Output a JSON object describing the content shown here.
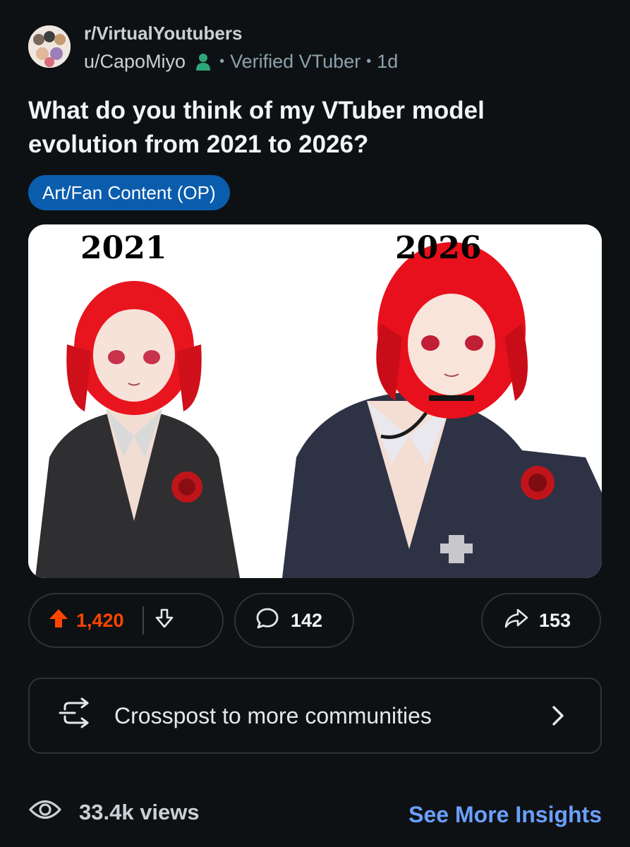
{
  "post": {
    "subreddit": "r/VirtualYoutubers",
    "author": "u/CapoMiyo",
    "user_flair": "Verified VTuber",
    "age": "1d",
    "title": "What do you think of my VTuber model evolution from 2021 to 2026?",
    "post_flair": "Art/Fan Content (OP)",
    "media": {
      "left_label": "2021",
      "right_label": "2026"
    }
  },
  "actions": {
    "upvotes": "1,420",
    "comments": "142",
    "shares": "153",
    "crosspost_label": "Crosspost to more communities"
  },
  "footer": {
    "views": "33.4k views",
    "insights_label": "See More Insights"
  },
  "colors": {
    "background": "#0e1113",
    "upvote_active": "#ff4500",
    "flair_bg": "#0a5cad",
    "link": "#6b9fff",
    "verified": "#2fa67a"
  },
  "icons": {
    "upvote": "arrow-up-filled-icon",
    "downvote": "arrow-down-outline-icon",
    "comment": "speech-bubble-icon",
    "share": "share-arrow-icon",
    "crosspost": "crosspost-arrows-icon",
    "chevron": "chevron-right-icon",
    "views": "eye-icon",
    "verified": "person-icon"
  }
}
